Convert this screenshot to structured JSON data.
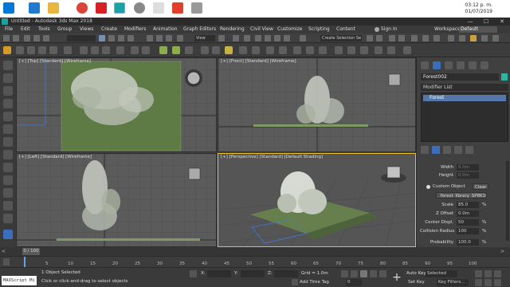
{
  "taskbar": {
    "clock_time": "03:12 p. m.",
    "clock_date": "01/07/2019"
  },
  "window": {
    "title": "Untitled - Autodesk 3ds Max 2018",
    "minimize": "—",
    "maximize": "☐",
    "close": "✕"
  },
  "menu": {
    "items": [
      "File",
      "Edit",
      "Tools",
      "Group",
      "Views",
      "Create",
      "Modifiers",
      "Animation",
      "Graph Editors",
      "Rendering",
      "Civil View",
      "Customize",
      "Scripting",
      "Content"
    ],
    "sign_in": "Sign In",
    "workspaces_label": "Workspaces:",
    "workspace_value": "Default"
  },
  "toolbar": {
    "view_dropdown": "View",
    "selection_set": "Create Selection Se"
  },
  "viewports": {
    "top": "[+] [Top] [Standard] [Wireframe]",
    "front": "[+] [Front] [Standard] [Wireframe]",
    "left": "[+] [Left] [Standard] [Wireframe]",
    "perspective": "[+] [Perspective] [Standard] [Default Shading]"
  },
  "command_panel": {
    "object_name": "Forest002",
    "modifier_list": "Modifier List",
    "stack_item": "Forest",
    "params": {
      "width_label": "Width",
      "width_value": "0.0m",
      "height_label": "Height",
      "height_value": "0.0m",
      "custom_object_label": "Custom Object",
      "clear_label": "Clear",
      "library_file": "_forest_library_SP8K1QA",
      "scale_label": "Scale",
      "scale_value": "85.0",
      "scale_unit": "%",
      "zoffset_label": "Z Offset",
      "zoffset_value": "0.0m",
      "center_label": "Center Displ.",
      "center_value": "50",
      "center_unit": "%",
      "collision_label": "Collision Radius",
      "collision_value": "100",
      "collision_unit": "%",
      "probability_label": "Probability",
      "probability_value": "100.0",
      "probability_unit": "%"
    }
  },
  "timeline": {
    "slider_label": "0 / 100",
    "ticks": [
      "5",
      "10",
      "15",
      "20",
      "25",
      "30",
      "35",
      "40",
      "45",
      "50",
      "55",
      "60",
      "65",
      "70",
      "75",
      "80",
      "85",
      "90",
      "95",
      "100"
    ]
  },
  "status": {
    "maxscript": "MAXScript Mi",
    "selected": "1 Object Selected",
    "prompt": "Click or click-and-drag to select objects",
    "x_label": "X:",
    "y_label": "Y:",
    "z_label": "Z:",
    "grid": "Grid = 1.0m",
    "add_time_tag": "Add Time Tag",
    "auto_key": "Auto Key",
    "set_key": "Set Key",
    "selected_dd": "Selected",
    "key_filters": "Key Filters...",
    "frame": "0"
  }
}
